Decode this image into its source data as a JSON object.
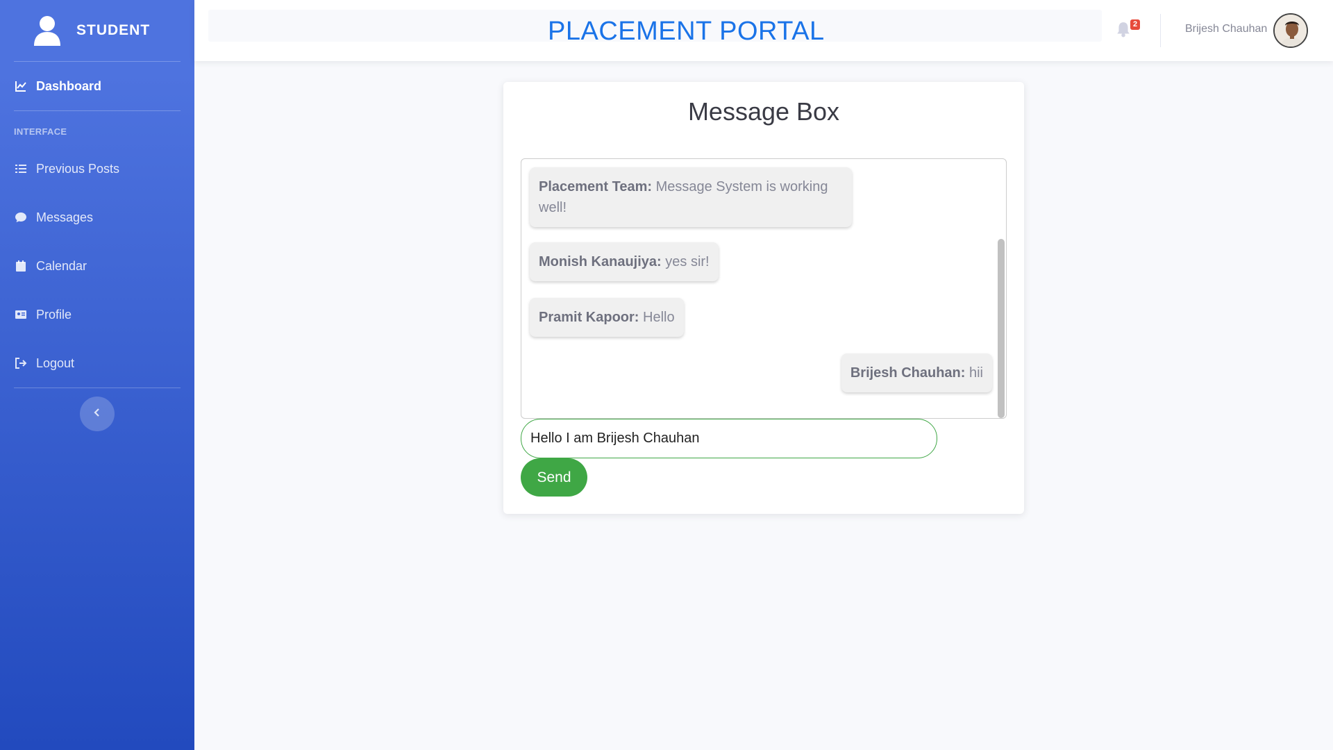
{
  "sidebar": {
    "brand": "STUDENT",
    "dashboard": "Dashboard",
    "section_heading": "INTERFACE",
    "items": [
      {
        "label": "Previous Posts",
        "icon": "list-icon"
      },
      {
        "label": "Messages",
        "icon": "chat-bubble-icon"
      },
      {
        "label": "Calendar",
        "icon": "calendar-icon"
      },
      {
        "label": "Profile",
        "icon": "id-card-icon"
      },
      {
        "label": "Logout",
        "icon": "logout-icon"
      }
    ]
  },
  "topbar": {
    "title": "PLACEMENT PORTAL",
    "notification_count": "2",
    "username": "Brijesh Chauhan"
  },
  "message_box": {
    "title": "Message Box",
    "messages": [
      {
        "sender": "Placement Team:",
        "text": "Message System is working well!"
      },
      {
        "sender": "Monish Kanaujiya:",
        "text": "yes sir!"
      },
      {
        "sender": "Pramit Kapoor:",
        "text": "Hello"
      },
      {
        "sender": "Brijesh Chauhan:",
        "text": "hii"
      }
    ],
    "input_value": "Hello I am Brijesh Chauhan",
    "send_label": "Send"
  },
  "colors": {
    "sidebar_start": "#4e73df",
    "sidebar_end": "#224abe",
    "title_blue": "#1a73e8",
    "send_green": "#3fa745",
    "badge_red": "#e74a3b"
  }
}
